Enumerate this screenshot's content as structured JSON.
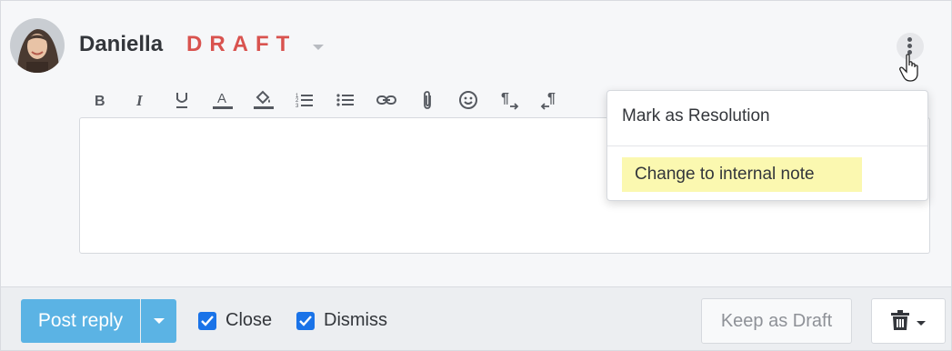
{
  "header": {
    "author_name": "Daniella",
    "status": "DRAFT"
  },
  "toolbar": {
    "buttons": [
      {
        "icon": "bold-icon"
      },
      {
        "icon": "italic-icon"
      },
      {
        "icon": "underline-icon"
      },
      {
        "icon": "text-color-icon"
      },
      {
        "icon": "highlight-color-icon"
      },
      {
        "icon": "numbered-list-icon"
      },
      {
        "icon": "bulleted-list-icon"
      },
      {
        "icon": "link-icon"
      },
      {
        "icon": "attachment-icon"
      },
      {
        "icon": "emoji-icon"
      },
      {
        "icon": "ltr-direction-icon"
      },
      {
        "icon": "rtl-direction-icon"
      }
    ]
  },
  "menu": {
    "items": [
      {
        "label": "Mark as Resolution"
      },
      {
        "label": "Change to internal note"
      }
    ]
  },
  "footer": {
    "post_label": "Post reply",
    "close_label": "Close",
    "dismiss_label": "Dismiss",
    "keep_draft_label": "Keep as Draft",
    "close_checked": true,
    "dismiss_checked": true
  },
  "colors": {
    "accent": "#5bb3e4",
    "draft": "#d9534f",
    "checkbox": "#1a73e8",
    "highlight": "#fbf8b0"
  }
}
